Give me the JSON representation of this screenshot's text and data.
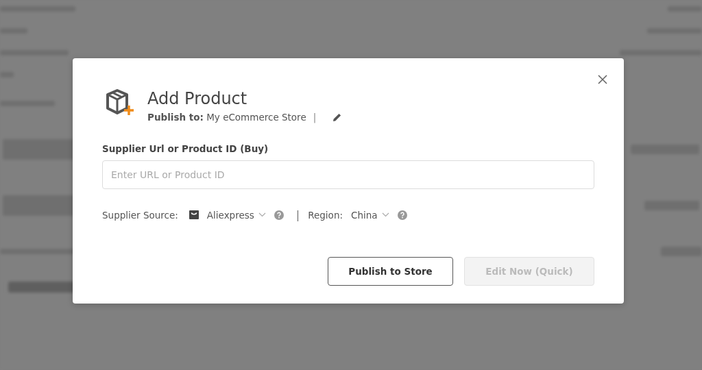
{
  "dialog": {
    "title": "Add Product",
    "publish_to": {
      "label": "Publish to:",
      "value": "My eCommerce Store",
      "separator": "|"
    },
    "url_field": {
      "label": "Supplier Url or Product ID (Buy)",
      "placeholder": "Enter URL or Product ID"
    },
    "supplier_source": {
      "label": "Supplier Source:",
      "value": "Aliexpress"
    },
    "separator": "|",
    "region": {
      "label": "Region:",
      "value": "China"
    },
    "buttons": [
      {
        "label": "Publish to Store",
        "disabled": false
      },
      {
        "label": "Edit Now (Quick)",
        "disabled": true
      }
    ]
  }
}
